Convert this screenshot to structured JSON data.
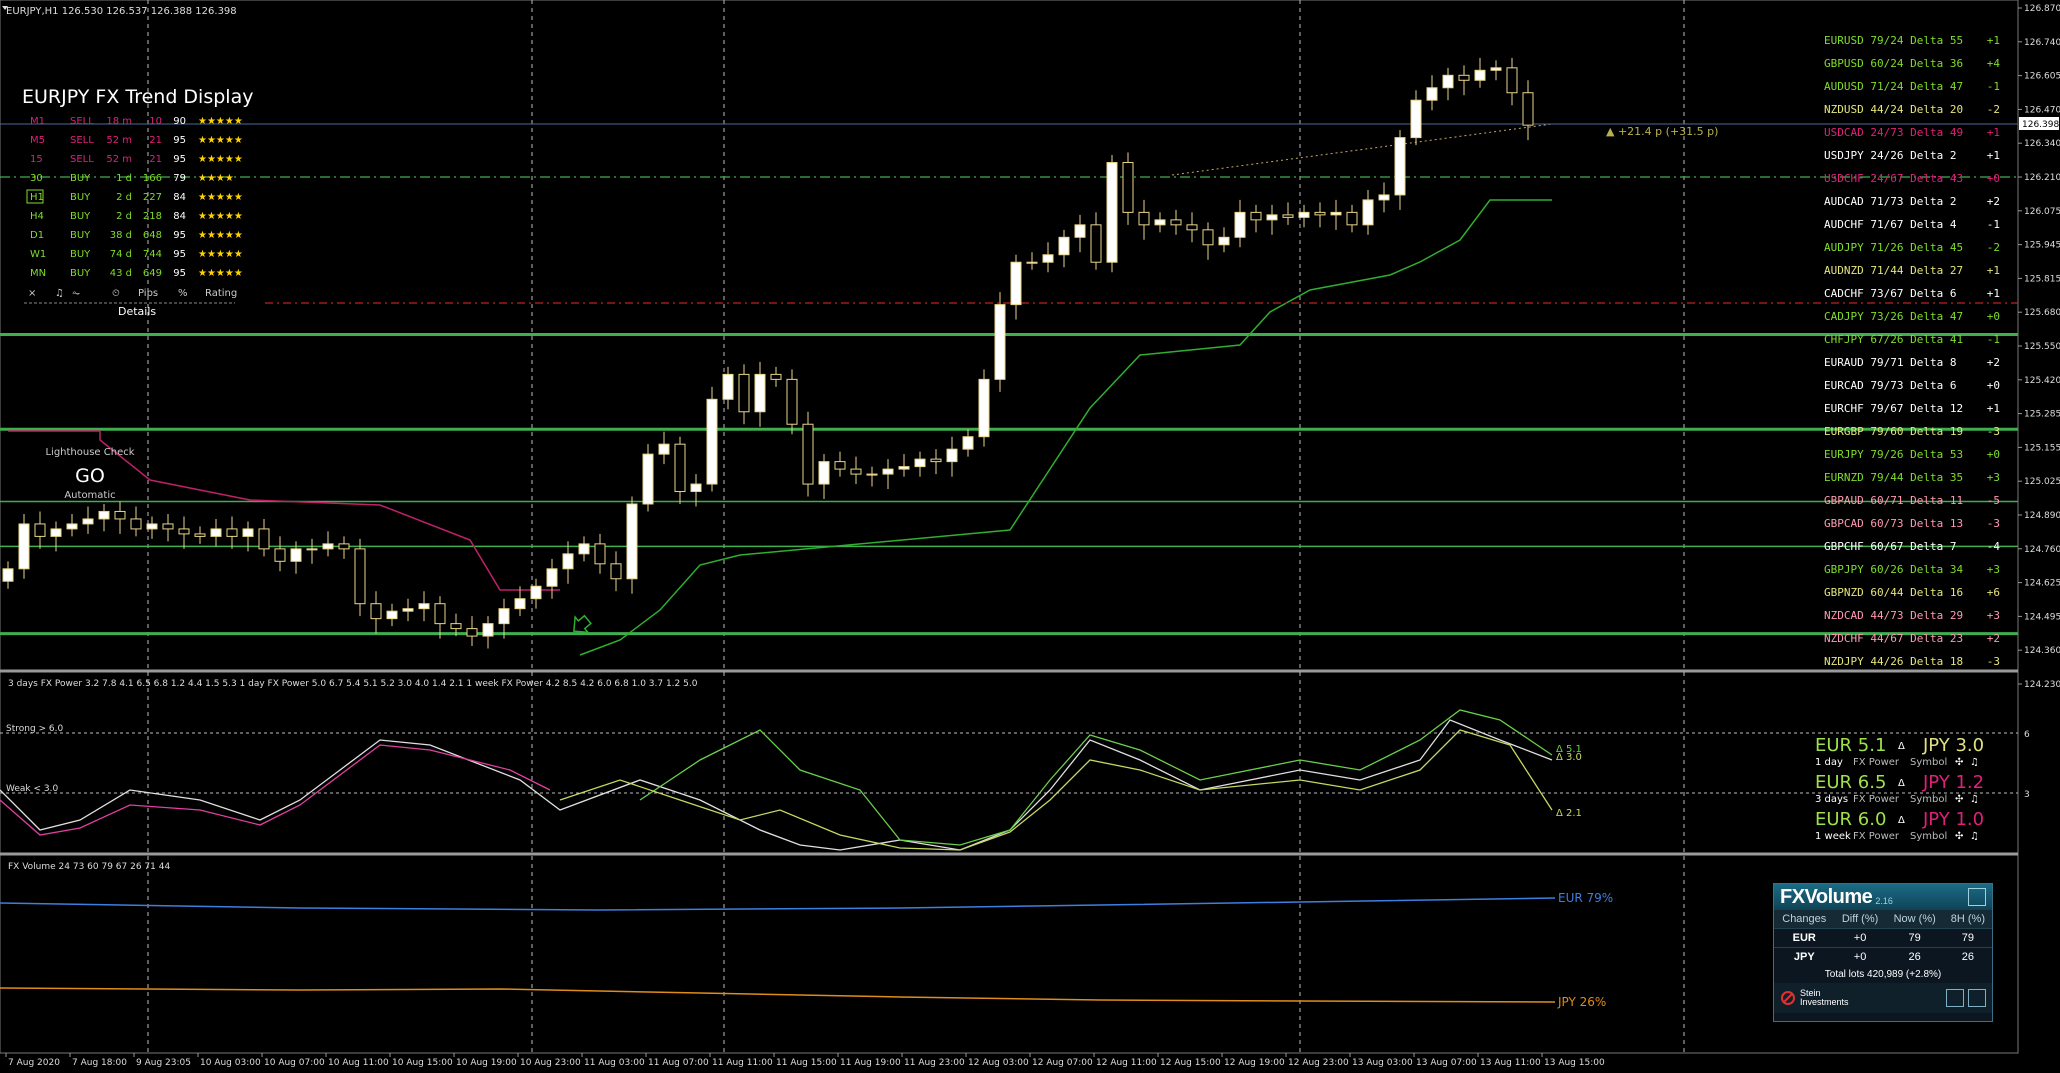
{
  "window": {
    "title": "EURJPY,H1",
    "quote": "126.530 126.537 126.388 126.398",
    "current_price": "126.398"
  },
  "price_axis": [
    "126.870",
    "126.740",
    "126.605",
    "126.470",
    "126.340",
    "126.210",
    "126.075",
    "125.945",
    "125.815",
    "125.680",
    "125.550",
    "125.420",
    "125.285",
    "125.155",
    "125.025",
    "124.890",
    "124.760",
    "124.625",
    "124.495",
    "124.360",
    "124.230"
  ],
  "time_axis": [
    "7 Aug 2020",
    "7 Aug 18:00",
    "9 Aug 23:05",
    "10 Aug 03:00",
    "10 Aug 07:00",
    "10 Aug 11:00",
    "10 Aug 15:00",
    "10 Aug 19:00",
    "10 Aug 23:00",
    "11 Aug 03:00",
    "11 Aug 07:00",
    "11 Aug 11:00",
    "11 Aug 15:00",
    "11 Aug 19:00",
    "11 Aug 23:00",
    "12 Aug 03:00",
    "12 Aug 07:00",
    "12 Aug 11:00",
    "12 Aug 15:00",
    "12 Aug 19:00",
    "12 Aug 23:00",
    "13 Aug 03:00",
    "13 Aug 07:00",
    "13 Aug 11:00",
    "13 Aug 15:00"
  ],
  "trend_display": {
    "title": "EURJPY FX Trend Display",
    "rows": [
      {
        "tf": "M1",
        "signal": "SELL",
        "age": "18 m",
        "pips": "10",
        "pct": "90",
        "stars": "★★★★★",
        "color": "#e0207a"
      },
      {
        "tf": "M5",
        "signal": "SELL",
        "age": "52 m",
        "pips": "21",
        "pct": "95",
        "stars": "★★★★★",
        "color": "#e0207a"
      },
      {
        "tf": "15",
        "signal": "SELL",
        "age": "52 m",
        "pips": "21",
        "pct": "95",
        "stars": "★★★★★",
        "color": "#e0207a"
      },
      {
        "tf": "30",
        "signal": "BUY",
        "age": "1 d",
        "pips": "166",
        "pct": "79",
        "stars": "★★★★",
        "color": "#7fdd2a"
      },
      {
        "tf": "H1",
        "signal": "BUY",
        "age": "2 d",
        "pips": "227",
        "pct": "84",
        "stars": "★★★★★",
        "color": "#7fdd2a"
      },
      {
        "tf": "H4",
        "signal": "BUY",
        "age": "2 d",
        "pips": "218",
        "pct": "84",
        "stars": "★★★★★",
        "color": "#7fdd2a"
      },
      {
        "tf": "D1",
        "signal": "BUY",
        "age": "38 d",
        "pips": "648",
        "pct": "95",
        "stars": "★★★★★",
        "color": "#7fdd2a"
      },
      {
        "tf": "W1",
        "signal": "BUY",
        "age": "74 d",
        "pips": "744",
        "pct": "95",
        "stars": "★★★★★",
        "color": "#7fdd2a"
      },
      {
        "tf": "MN",
        "signal": "BUY",
        "age": "43 d",
        "pips": "649",
        "pct": "95",
        "stars": "★★★★★",
        "color": "#7fdd2a"
      }
    ],
    "footer": {
      "close": "×",
      "pips": "Pips",
      "pct": "%",
      "rating": "Rating"
    },
    "details_label": "Details"
  },
  "lighthouse": {
    "label": "Lighthouse Check",
    "status": "GO",
    "mode": "Automatic"
  },
  "target_label": "+21.4 p (+31.5 p)",
  "pair_list": [
    {
      "text": "EURUSD 79/24 Delta 55",
      "delta": "+1",
      "color": "#7fdd2a"
    },
    {
      "text": "GBPUSD 60/24 Delta 36",
      "delta": "+4",
      "color": "#7fdd2a"
    },
    {
      "text": "AUDUSD 71/24 Delta 47",
      "delta": "-1",
      "color": "#7fdd2a"
    },
    {
      "text": "NZDUSD 44/24 Delta 20",
      "delta": "-2",
      "color": "#e6e67a"
    },
    {
      "text": "USDCAD 24/73 Delta 49",
      "delta": "+1",
      "color": "#e0207a"
    },
    {
      "text": "USDJPY 24/26 Delta  2",
      "delta": "+1",
      "color": "#ffffff"
    },
    {
      "text": "USDCHF 24/67 Delta 43",
      "delta": "+0",
      "color": "#e0207a"
    },
    {
      "text": "AUDCAD 71/73 Delta  2",
      "delta": "+2",
      "color": "#ffffff"
    },
    {
      "text": "AUDCHF 71/67 Delta  4",
      "delta": "-1",
      "color": "#ffffff"
    },
    {
      "text": "AUDJPY 71/26 Delta 45",
      "delta": "-2",
      "color": "#7fdd2a"
    },
    {
      "text": "AUDNZD 71/44 Delta 27",
      "delta": "+1",
      "color": "#e6e67a"
    },
    {
      "text": "CADCHF 73/67 Delta  6",
      "delta": "+1",
      "color": "#ffffff"
    },
    {
      "text": "CADJPY 73/26 Delta 47",
      "delta": "+0",
      "color": "#7fdd2a"
    },
    {
      "text": "CHFJPY 67/26 Delta 41",
      "delta": "-1",
      "color": "#7fdd2a"
    },
    {
      "text": "EURAUD 79/71 Delta  8",
      "delta": "+2",
      "color": "#ffffff"
    },
    {
      "text": "EURCAD 79/73 Delta  6",
      "delta": "+0",
      "color": "#ffffff"
    },
    {
      "text": "EURCHF 79/67 Delta 12",
      "delta": "+1",
      "color": "#ffffff"
    },
    {
      "text": "EURGBP 79/60 Delta 19",
      "delta": "-3",
      "color": "#e6e67a"
    },
    {
      "text": "EURJPY 79/26 Delta 53",
      "delta": "+0",
      "color": "#7fdd2a"
    },
    {
      "text": "EURNZD 79/44 Delta 35",
      "delta": "+3",
      "color": "#7fdd2a"
    },
    {
      "text": "GBPAUD 60/71 Delta 11",
      "delta": "-5",
      "color": "#ff9ab5"
    },
    {
      "text": "GBPCAD 60/73 Delta 13",
      "delta": "-3",
      "color": "#ff9ab5"
    },
    {
      "text": "GBPCHF 60/67 Delta  7",
      "delta": "-4",
      "color": "#ffffff"
    },
    {
      "text": "GBPJPY 60/26 Delta 34",
      "delta": "+3",
      "color": "#7fdd2a"
    },
    {
      "text": "GBPNZD 60/44 Delta 16",
      "delta": "+6",
      "color": "#e6e67a"
    },
    {
      "text": "NZDCAD 44/73 Delta 29",
      "delta": "+3",
      "color": "#ff9ab5"
    },
    {
      "text": "NZDCHF 44/67 Delta 23",
      "delta": "+2",
      "color": "#ff9ab5"
    },
    {
      "text": "NZDJPY 44/26 Delta 18",
      "delta": "-3",
      "color": "#e6e67a"
    }
  ],
  "fx_power": {
    "header": "3 days FX Power 3.2 7.8 4.1 6.5 6.8 1.2 4.4 1.5 5.3   1 day FX Power 5.0 6.7 5.4 5.1 5.2 3.0 4.0 1.4 2.1   1 week FX Power 4.2 8.5 4.2 6.0 6.8 1.0 3.7 1.2 5.0",
    "strong_label": "Strong > 6.0",
    "weak_label": "Weak < 3.0",
    "line_labels": [
      "Δ 5.1",
      "Δ 3.0",
      "Δ 2.1"
    ],
    "panels": [
      {
        "eur": "EUR 5.1",
        "jpy": "JPY 3.0",
        "period": "1 day",
        "jpy_color": "#e0e080"
      },
      {
        "eur": "EUR 6.5",
        "jpy": "JPY 1.2",
        "period": "3 days",
        "jpy_color": "#e0207a"
      },
      {
        "eur": "EUR 6.0",
        "jpy": "JPY 1.0",
        "period": "1 week",
        "jpy_color": "#e0207a"
      }
    ],
    "delta_symbol": "Δ",
    "fx_power_label": "FX Power",
    "symbol_label": "Symbol",
    "y_ticks": [
      "6",
      "3"
    ]
  },
  "fx_volume_line": {
    "header": "FX Volume 24 73 60 79 67 26 71 44",
    "eur_label": "EUR 79%",
    "jpy_label": "JPY 26%"
  },
  "fx_volume_widget": {
    "logo": "FXVolume",
    "version": "2.16",
    "columns": [
      "Changes",
      "Diff (%)",
      "Now (%)",
      "8H (%)"
    ],
    "rows": [
      {
        "cur": "EUR",
        "diff": "+0",
        "now": "79",
        "h8": "79"
      },
      {
        "cur": "JPY",
        "diff": "+0",
        "now": "26",
        "h8": "26"
      }
    ],
    "total": "Total lots 420,989 (+2.8%)",
    "brand_1": "Stein",
    "brand_2": "Investments"
  },
  "colors": {
    "bull": "#ffffff",
    "bear": "#ffffff",
    "candle_outline": "#e8d48a",
    "green": "#3dbd3d",
    "pink": "#e0207a",
    "level_green": "#3fae4f",
    "eur_volume": "#3c7fe0",
    "jpy_volume": "#e08c1a"
  },
  "chart_data": {
    "type": "candlestick",
    "symbol": "EURJPY",
    "timeframe": "H1",
    "close": [
      124.62,
      124.8,
      124.75,
      124.78,
      124.8,
      124.82,
      124.85,
      124.82,
      124.78,
      124.8,
      124.78,
      124.76,
      124.75,
      124.78,
      124.75,
      124.78,
      124.7,
      124.65,
      124.7,
      124.7,
      124.72,
      124.7,
      124.48,
      124.42,
      124.45,
      124.46,
      124.48,
      124.4,
      124.38,
      124.35,
      124.4,
      124.46,
      124.5,
      124.55,
      124.62,
      124.68,
      124.72,
      124.64,
      124.58,
      124.88,
      125.08,
      125.12,
      124.93,
      124.96,
      125.3,
      125.4,
      125.25,
      125.4,
      125.38,
      125.2,
      124.96,
      125.05,
      125.02,
      125.0,
      125.0,
      125.02,
      125.03,
      125.06,
      125.05,
      125.1,
      125.15,
      125.38,
      125.68,
      125.85,
      125.85,
      125.88,
      125.95,
      126.0,
      125.85,
      126.25,
      126.05,
      126.0,
      126.02,
      126.0,
      125.98,
      125.92,
      125.95,
      126.05,
      126.02,
      126.04,
      126.03,
      126.05,
      126.04,
      126.05,
      126.0,
      126.1,
      126.12,
      126.35,
      126.5,
      126.55,
      126.6,
      126.58,
      126.62,
      126.63,
      126.53,
      126.4
    ],
    "levels": [
      125.67,
      125.56,
      125.18,
      124.89,
      124.71,
      124.36
    ],
    "ylim": [
      124.23,
      126.87
    ]
  }
}
